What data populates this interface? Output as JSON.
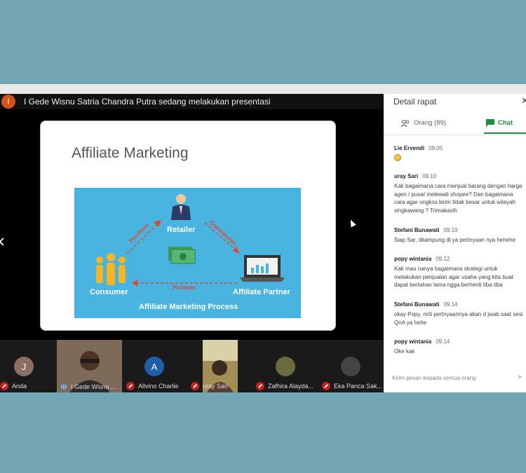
{
  "presenter": {
    "initial": "I",
    "banner": "I Gede Wisnu Satria Chandra Putra sedang melakukan presentasi"
  },
  "slide": {
    "title": "Affiliate Marketing",
    "retailer": "Retailer",
    "consumer": "Consumer",
    "affiliate_partner": "Affiliate Partner",
    "process": "Affiliate Marketing Process",
    "purchase": "Purchase",
    "commission": "Commission",
    "promote": "Promote"
  },
  "participants": [
    {
      "initial": "J",
      "name": "Anda",
      "avatar_color": "#8d6e63",
      "mic": "off"
    },
    {
      "initial": "",
      "name": "I Gede Wisnu ...",
      "avatar_color": "#6b5a4a",
      "mic": "on"
    },
    {
      "initial": "A",
      "name": "Allvino Charlie",
      "avatar_color": "#1e5fa8",
      "mic": "off"
    },
    {
      "initial": "",
      "name": "uray Sari",
      "avatar_color": "#7c6a3a",
      "mic": "off"
    },
    {
      "initial": "",
      "name": "Zafhira Alayda...",
      "avatar_color": "#6b6b3e",
      "mic": "off"
    },
    {
      "initial": "",
      "name": "Eka Panca Sak...",
      "avatar_color": "#444",
      "mic": "off"
    }
  ],
  "side_panel": {
    "title": "Detail rapat",
    "close_icon": "close-icon",
    "tab_people": "Orang (89)",
    "tab_chat": "Chat",
    "input_placeholder": "Kirim pesan kepada semua orang"
  },
  "chat": [
    {
      "sender": "Lie Ervendi",
      "time": "09.05",
      "text": ""
    },
    {
      "sender": "uray Sari",
      "time": "09.10",
      "text": "Kak bagaimana cara menjual barang dengan harga agen / pusat melewati shopee? Dan bagaimana cara agar ongkos kirim tidak besar untuk wilayah singkawang ? Trimakasih"
    },
    {
      "sender": "Stefani Bunawati",
      "time": "09.10",
      "text": "Siap Sar, ditampung dl ya pertnyaan nya hehehe"
    },
    {
      "sender": "popy wintania",
      "time": "09.12",
      "text": "Kak mau nanya bagaimana strategi untuk melakukan penjualan agar usaha yang kita buat dapat bertahan lama ngga berhenti tiba tiba"
    },
    {
      "sender": "Stefani Bunawati",
      "time": "09.14",
      "text": "okay Popy, nnti pertnyaannya akan d jwab saat sesi QnA ya hehe"
    },
    {
      "sender": "popy wintania",
      "time": "09.14",
      "text": "Oke kak"
    }
  ],
  "colors": {
    "background": "#74a5b5",
    "accent_green": "#1e8e3e",
    "mic_off": "#c5221f",
    "slide_diagram": "#4ab4e0"
  }
}
